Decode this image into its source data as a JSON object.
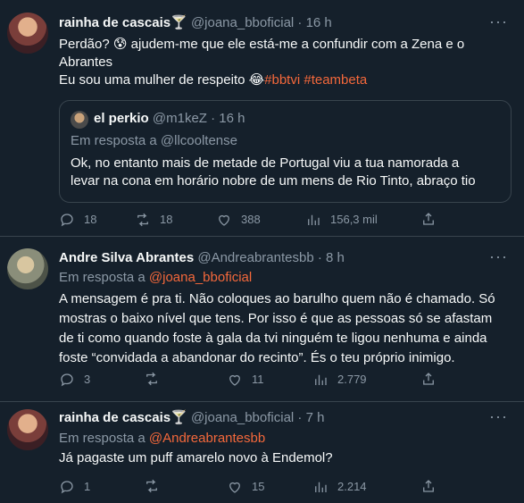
{
  "tweets": [
    {
      "name": "rainha de cascais🍸",
      "handle": "@joana_bboficial",
      "time": "· 16 h",
      "text_line1": "Perdão? 😰 ajudem-me que ele está-me a confundir com a Zena e o",
      "text_line2": "Abrantes",
      "text_line3_prefix": "Eu sou uma mulher de respeito 😂",
      "hashtag1": "#bbtvi",
      "hashtag2": "#teambeta",
      "more": "···",
      "quote": {
        "name": "el perkio",
        "handle": "@m1keZ",
        "time": "· 16 h",
        "reply_to_prefix": "Em resposta a",
        "reply_to": "@llcooltense",
        "text_line1": "Ok, no entanto mais de metade de Portugal viu a tua namorada a",
        "text_line2": "levar na cona em horário nobre de um mens de Rio Tinto, abraço tio"
      },
      "replies": "18",
      "retweets": "18",
      "likes": "388",
      "views": "156,3 mil"
    },
    {
      "name": "Andre Silva Abrantes",
      "handle": "@Andreabrantesbb",
      "time": "· 8 h",
      "reply_to_prefix": "Em resposta a",
      "reply_to": "@joana_bboficial",
      "text_line1": "A mensagem é pra ti. Não coloques ao barulho quem não é chamado. Só",
      "text_line2": "mostras o baixo nível que tens. Por isso é que as pessoas só se afastam",
      "text_line3": "de ti como quando foste à gala da tvi ninguém te ligou nenhuma e ainda",
      "text_line4": "foste “convidada a abandonar do recinto”. És o teu próprio inimigo.",
      "more": "···",
      "replies": "3",
      "retweets": "",
      "likes": "11",
      "views": "2.779"
    },
    {
      "name": "rainha de cascais🍸",
      "handle": "@joana_bboficial",
      "time": "· 7 h",
      "reply_to_prefix": "Em resposta a",
      "reply_to": "@Andreabrantesbb",
      "text_line1": "Já pagaste um puff amarelo novo à Endemol?",
      "more": "···",
      "replies": "1",
      "retweets": "",
      "likes": "15",
      "views": "2.214"
    }
  ],
  "colors": {
    "background": "#15202b",
    "text": "#f7f9f9",
    "muted": "#8b98a5",
    "link": "#f4683b",
    "border": "#38444d"
  }
}
